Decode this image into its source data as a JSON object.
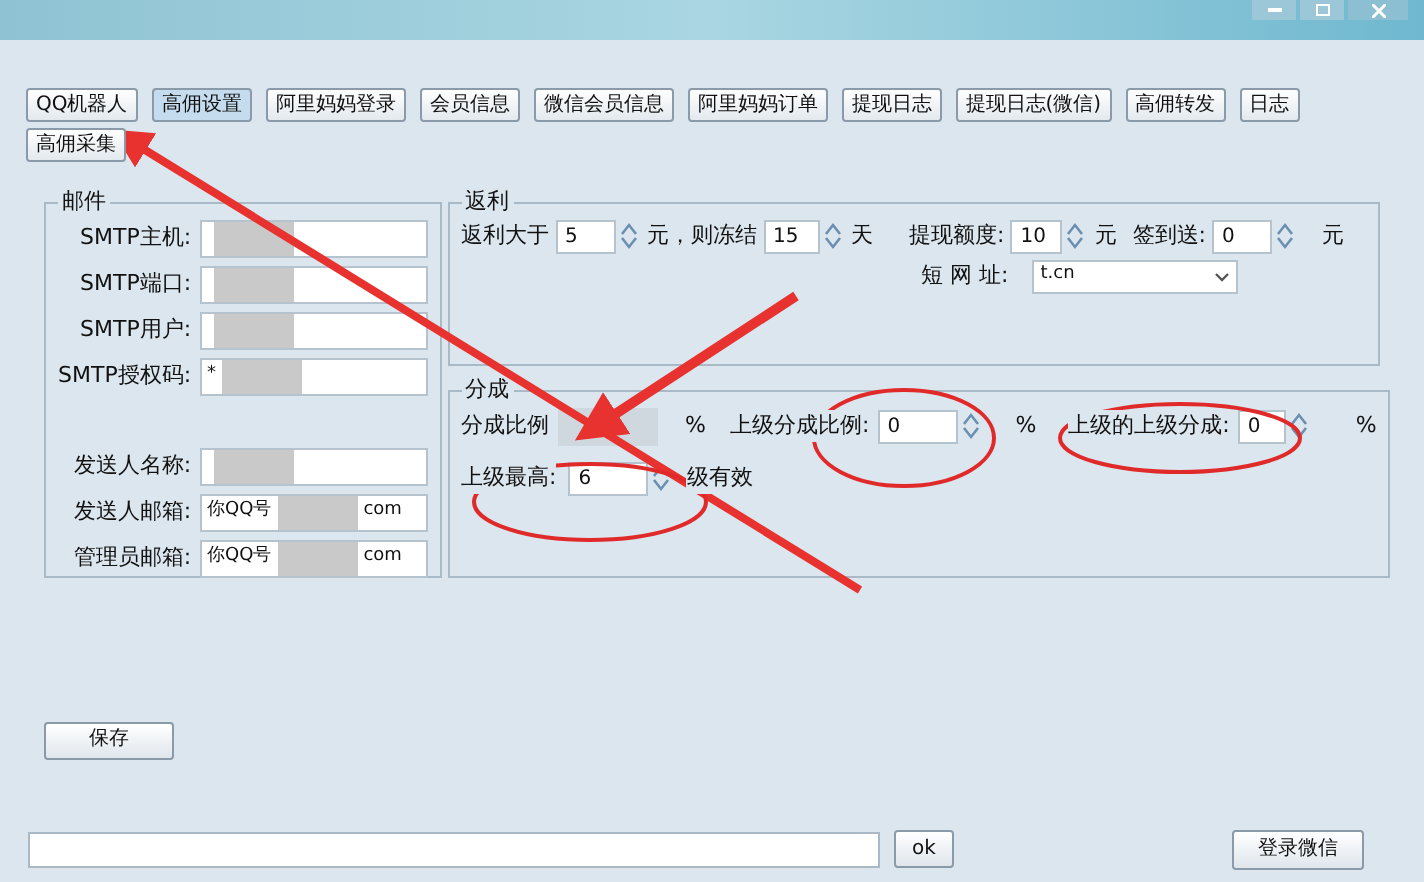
{
  "toolbar": [
    {
      "label": "QQ机器人",
      "selected": false
    },
    {
      "label": "高佣设置",
      "selected": true
    },
    {
      "label": "阿里妈妈登录",
      "selected": false
    },
    {
      "label": "会员信息",
      "selected": false
    },
    {
      "label": "微信会员信息",
      "selected": false
    },
    {
      "label": "阿里妈妈订单",
      "selected": false
    },
    {
      "label": "提现日志",
      "selected": false
    },
    {
      "label": "提现日志(微信)",
      "selected": false
    },
    {
      "label": "高佣转发",
      "selected": false
    },
    {
      "label": "日志",
      "selected": false
    },
    {
      "label": "高佣采集",
      "selected": false
    }
  ],
  "mail": {
    "title": "邮件",
    "fields": [
      {
        "label": "SMTP主机:"
      },
      {
        "label": "SMTP端口:"
      },
      {
        "label": "SMTP用户:"
      },
      {
        "label": "SMTP授权码:",
        "value": "*"
      },
      {
        "label": "发送人名称:"
      },
      {
        "label": "发送人邮箱:",
        "value": "你QQ号",
        "tail": "com"
      },
      {
        "label": "管理员邮箱:",
        "value": "你QQ号",
        "tail": "com"
      }
    ]
  },
  "rebate": {
    "title": "返利",
    "prefix": "返利大于",
    "amount": "5",
    "unit1": "元，则冻结",
    "days": "15",
    "unit2": "天",
    "withdraw_label": "提现额度:",
    "withdraw": "10",
    "withdraw_unit": "元",
    "checkin_label": "签到送:",
    "checkin": "0",
    "checkin_unit": "元",
    "short_url_label": "短 网 址:",
    "short_url": "t.cn"
  },
  "commission": {
    "title": "分成",
    "ratio_label": "分成比例",
    "ratio_unit": "%",
    "parent_label": "上级分成比例:",
    "parent": "0",
    "parent_unit": "%",
    "grand_label": "上级的上级分成:",
    "grand": "0",
    "grand_unit": "%",
    "max_label": "上级最高:",
    "max": "6",
    "max_suffix": "级有效"
  },
  "save_button": "保存",
  "bottom": {
    "ok_button": "ok",
    "login_button": "登录微信"
  }
}
